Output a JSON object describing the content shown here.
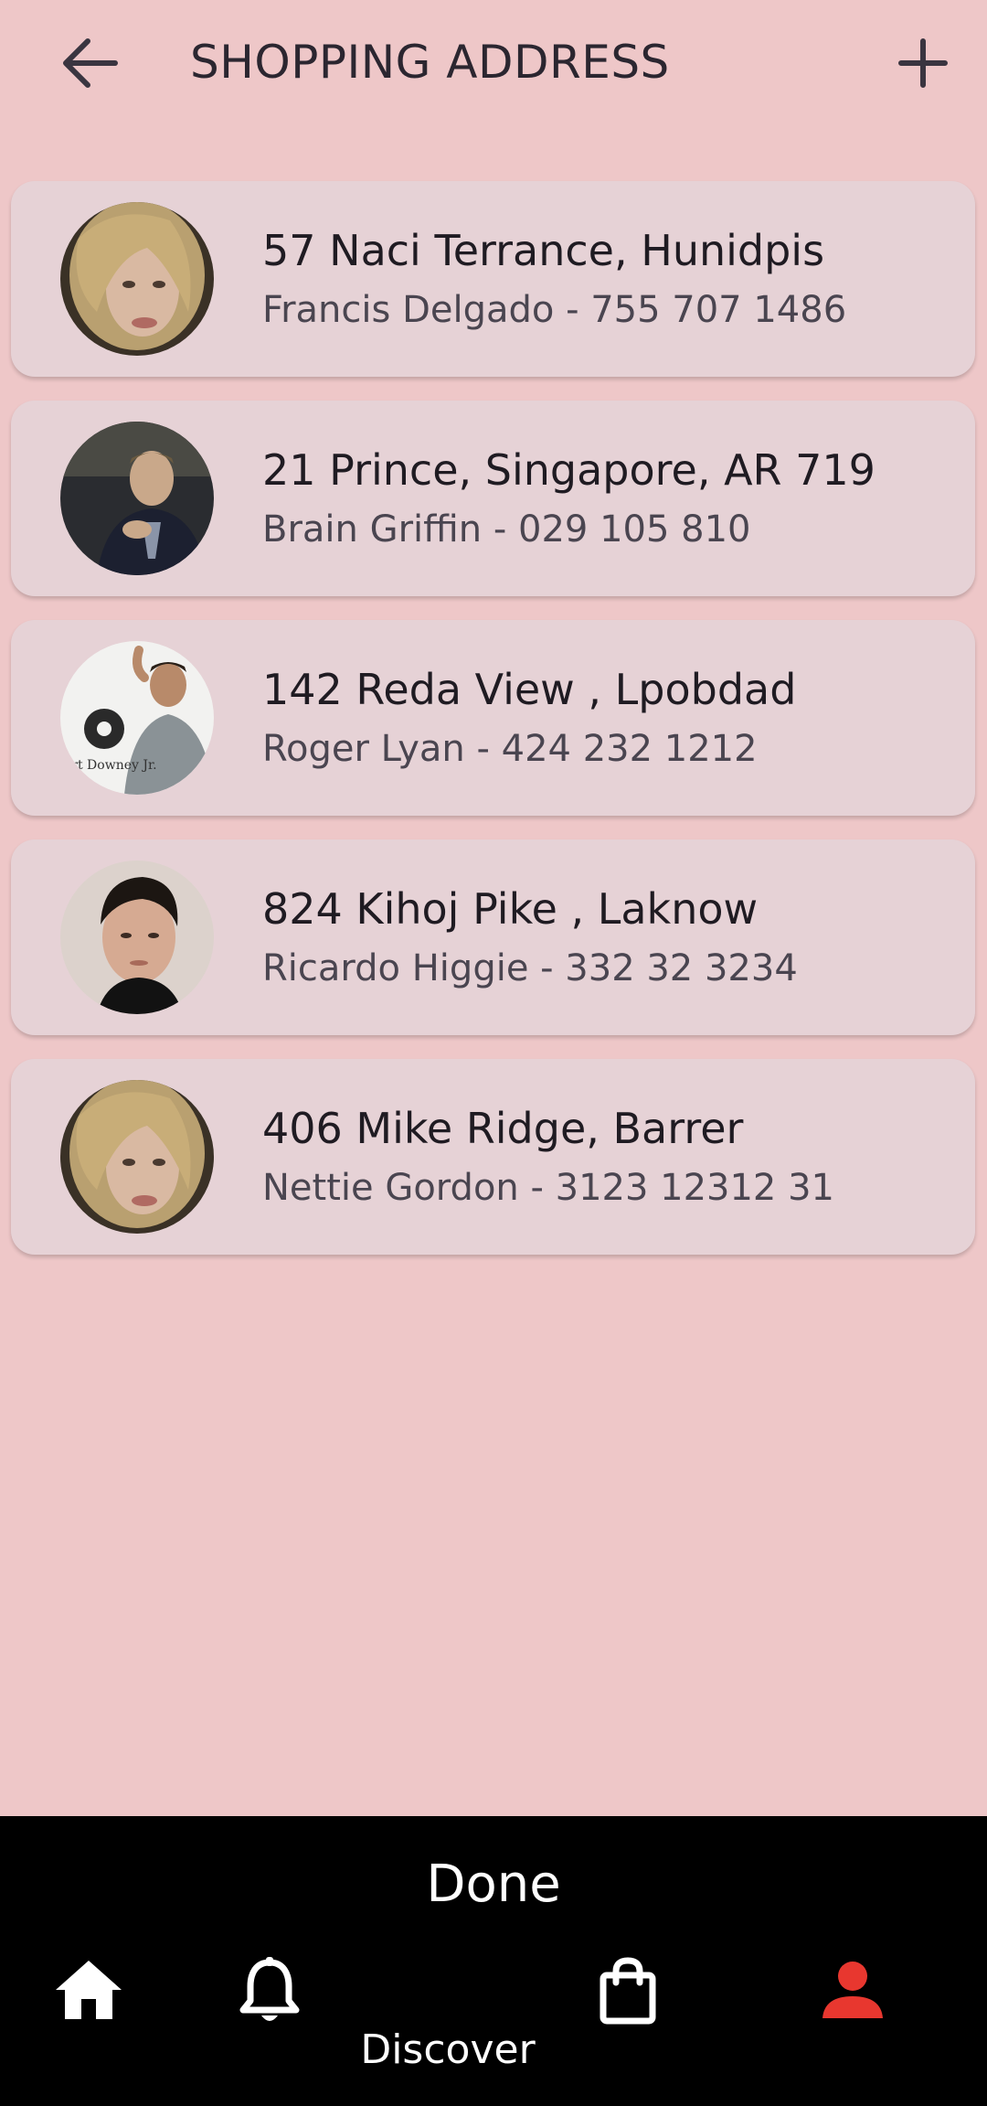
{
  "appbar": {
    "title": "SHOPPING ADDRESS",
    "back_icon": "arrow-left-icon",
    "add_icon": "plus-icon"
  },
  "addresses": [
    {
      "address": "57 Naci Terrance,  Hunidpis",
      "contact": "Francis Delgado - 755 707 1486",
      "avatar": "woman-blonde"
    },
    {
      "address": "21 Prince, Singapore, AR 719",
      "contact": "Brain Griffin - 029 105 810",
      "avatar": "man-dark-suit"
    },
    {
      "address": "142 Reda View  , Lpobdad",
      "contact": "Roger Lyan - 424 232 1212",
      "avatar": "man-grey-shirt"
    },
    {
      "address": "824 Kihoj Pike , Laknow",
      "contact": "Ricardo Higgie - 332 32 3234",
      "avatar": "man-dark-hair"
    },
    {
      "address": "406 Mike Ridge, Barrer",
      "contact": "Nettie Gordon - 3123 12312 31",
      "avatar": "woman-blonde"
    }
  ],
  "bottom": {
    "done_label": "Done",
    "discover_label": "Discover",
    "nav_icons": [
      "home-icon",
      "bell-icon",
      "shopping-bag-icon",
      "person-icon"
    ],
    "active_color": "#e8372f"
  },
  "colors": {
    "background": "#eec7c8",
    "card": "#e6d2d6"
  }
}
